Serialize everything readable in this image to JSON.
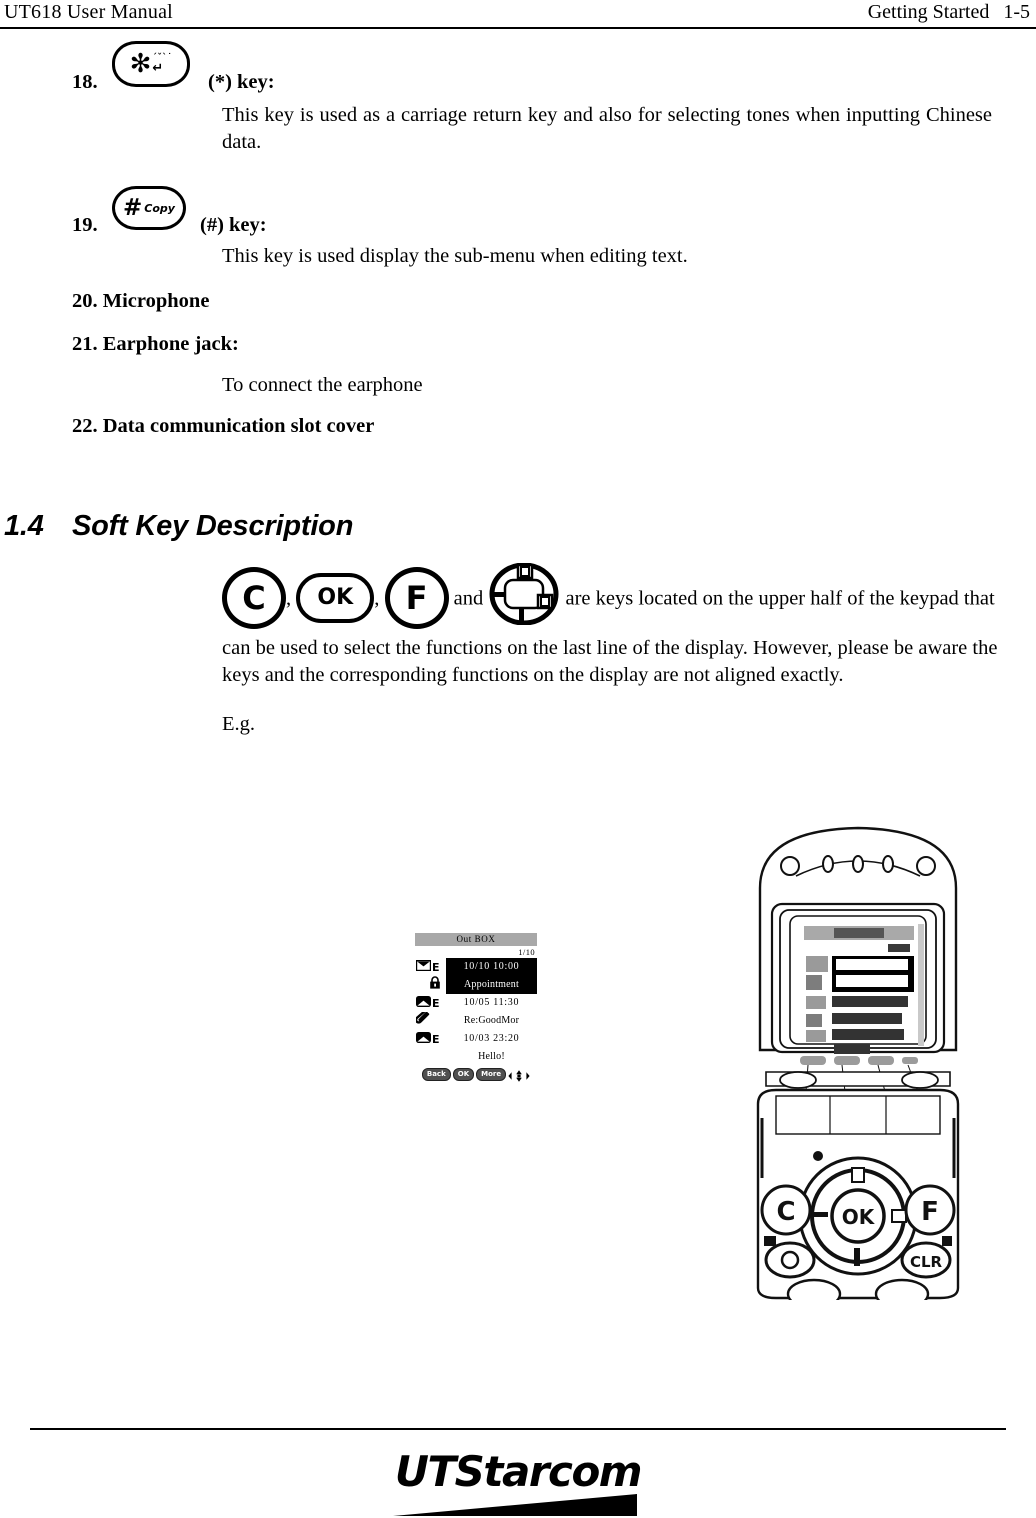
{
  "header": {
    "left_title": "UT618 User Manual",
    "right_title": "Getting Started",
    "page_number": "1-5"
  },
  "items": [
    {
      "number": "18.",
      "key_icon": "asterisk-key-icon",
      "key_glyph_main": "✻",
      "key_glyph_marks_row1": "ˊˇˋ˙",
      "key_glyph_marks_row2": "↵",
      "title": "(*) key:",
      "body": "This key is used as a carriage return key and also for selecting tones when inputting Chinese data."
    },
    {
      "number": "19.",
      "key_icon": "hash-key-icon",
      "key_glyph_main": "#",
      "key_glyph_marks_row1": "Copy",
      "title": "(#) key:",
      "body": "This key is used display the sub-menu when editing text."
    },
    {
      "number": "20.",
      "title": "20. Microphone"
    },
    {
      "number": "21.",
      "title": "21. Earphone jack:",
      "body": "To connect the earphone"
    },
    {
      "number": "22.",
      "title": "22. Data communication slot cover"
    }
  ],
  "section": {
    "number": "1.4",
    "title": "Soft Key Description",
    "keys": [
      {
        "name": "clear-key",
        "label": "C"
      },
      {
        "name": "ok-key",
        "label": "OK"
      },
      {
        "name": "function-key",
        "label": "F"
      },
      {
        "name": "navigation-key",
        "label": ""
      }
    ],
    "separator_comma": ",",
    "conjunction": "and",
    "paragraph": "are keys located on the upper half of the keypad that can be used to select the functions on the last line of the display. However, please be aware the keys and the corresponding functions on the display are not aligned exactly.",
    "example_label": "E.g."
  },
  "screen_mockup": {
    "title": "Out BOX",
    "counter": "1/10",
    "messages": [
      {
        "selected": true,
        "icons": [
          "envelope-sent-icon",
          "e-badge-icon",
          "lock-icon"
        ],
        "date_time": "10/10  10:00",
        "subject": "Appointment"
      },
      {
        "selected": false,
        "icons": [
          "envelope-icon",
          "e-badge-icon",
          "paperclip-icon"
        ],
        "date_time": "10/05  11:30",
        "subject": "Re:GoodMor"
      },
      {
        "selected": false,
        "icons": [
          "envelope-icon",
          "e-badge-icon"
        ],
        "date_time": "10/03  23:20",
        "subject": "Hello!"
      }
    ],
    "soft_keys": [
      "Back",
      "OK",
      "More"
    ],
    "nav_icon": "four-way-arrows-icon"
  },
  "phone_photo": {
    "alt": "UT618 flip phone front view showing message list screen and keypad",
    "keys_visible": [
      "C",
      "OK",
      "F",
      "CLR"
    ]
  },
  "footer": {
    "logo_ut": "UT",
    "logo_starcom": "Starcom"
  },
  "colors": {
    "text": "#000000",
    "screen_title_bg": "#a8a8a8",
    "screen_selected_bg": "#000000",
    "softkey_bg": "#505050"
  }
}
